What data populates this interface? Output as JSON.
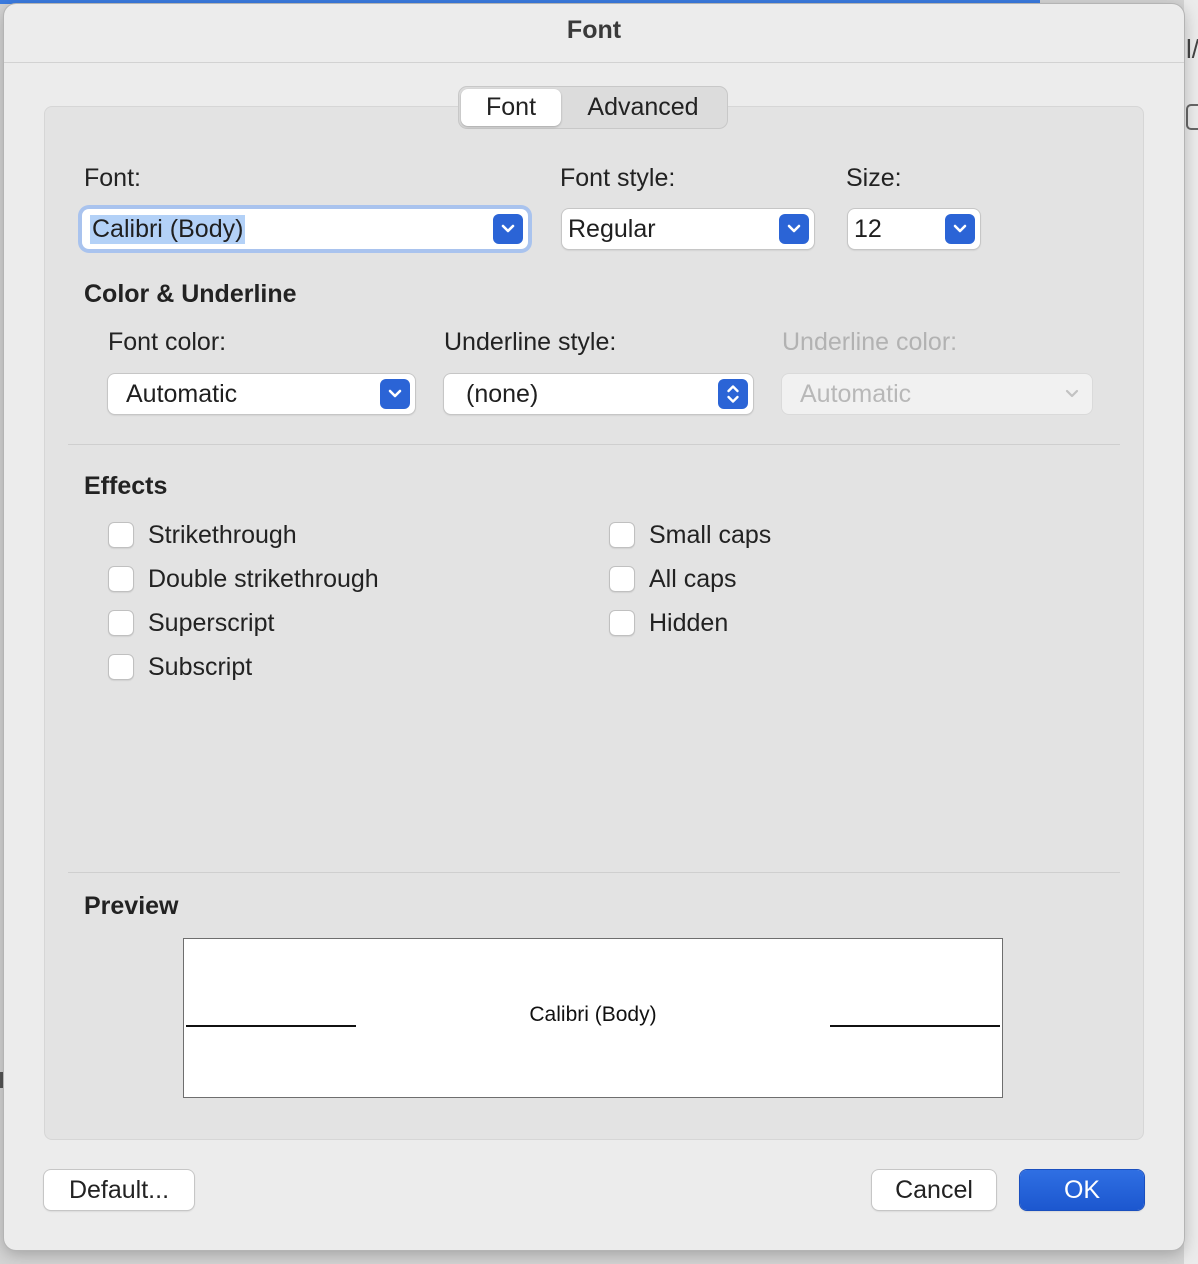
{
  "dialog": {
    "title": "Font"
  },
  "tabs": [
    {
      "label": "Font",
      "selected": true
    },
    {
      "label": "Advanced",
      "selected": false
    }
  ],
  "font": {
    "font_label": "Font:",
    "font_value": "Calibri (Body)",
    "style_label": "Font style:",
    "style_value": "Regular",
    "size_label": "Size:",
    "size_value": "12"
  },
  "color_underline": {
    "heading": "Color & Underline",
    "font_color_label": "Font color:",
    "font_color_value": "Automatic",
    "underline_style_label": "Underline style:",
    "underline_style_value": "(none)",
    "underline_color_label": "Underline color:",
    "underline_color_value": "Automatic"
  },
  "effects": {
    "heading": "Effects",
    "left": [
      {
        "label": "Strikethrough",
        "checked": false
      },
      {
        "label": "Double strikethrough",
        "checked": false
      },
      {
        "label": "Superscript",
        "checked": false
      },
      {
        "label": "Subscript",
        "checked": false
      }
    ],
    "right": [
      {
        "label": "Small caps",
        "checked": false
      },
      {
        "label": "All caps",
        "checked": false
      },
      {
        "label": "Hidden",
        "checked": false
      }
    ]
  },
  "preview": {
    "heading": "Preview",
    "sample_text": "Calibri (Body)"
  },
  "buttons": {
    "default_label": "Default...",
    "cancel_label": "Cancel",
    "ok_label": "OK"
  },
  "colors": {
    "accent": "#2b64d6",
    "selection": "#b3d1f7",
    "focus_ring": "#a9c3ee",
    "dialog_bg": "#ececec",
    "disabled_text": "#b2b2b2"
  },
  "icons": {
    "popup_arrow": "chevron-down-icon",
    "stepper_arrow": "up-down-chevron-icon"
  }
}
